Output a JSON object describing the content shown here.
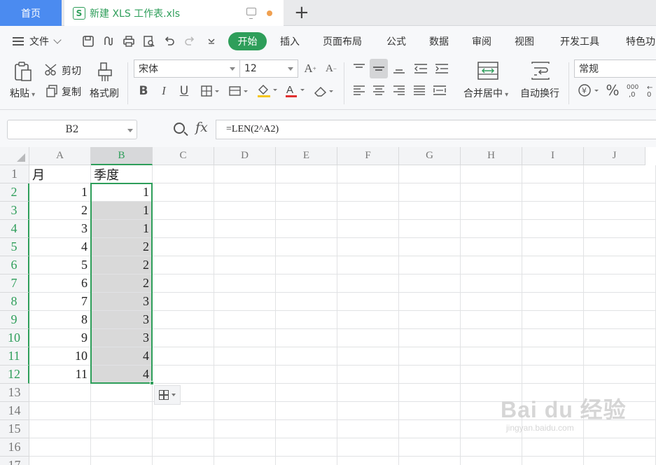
{
  "tabs": {
    "home": "首页",
    "doc_icon": "S",
    "doc_title": "新建 XLS 工作表.xls",
    "new_tab": "+"
  },
  "menu": {
    "file": "文件",
    "items": [
      "开始",
      "插入",
      "页面布局",
      "公式",
      "数据",
      "审阅",
      "视图",
      "开发工具",
      "特色功"
    ]
  },
  "ribbon": {
    "paste": "粘贴",
    "cut": "剪切",
    "copy": "复制",
    "format_painter": "格式刷",
    "font_name": "宋体",
    "font_size": "12",
    "merge_center": "合并居中",
    "wrap_text": "自动换行",
    "number_format": "常规"
  },
  "formula_bar": {
    "name_box": "B2",
    "fx": "fx",
    "formula": "=LEN(2^A2)"
  },
  "sheet": {
    "columns": [
      "A",
      "B",
      "C",
      "D",
      "E",
      "F",
      "G",
      "H",
      "I",
      "J"
    ],
    "active_column": "B",
    "rows": [
      {
        "n": "1",
        "a": "月",
        "b": "季度"
      },
      {
        "n": "2",
        "a": "1",
        "b": "1"
      },
      {
        "n": "3",
        "a": "2",
        "b": "1"
      },
      {
        "n": "4",
        "a": "3",
        "b": "1"
      },
      {
        "n": "5",
        "a": "4",
        "b": "2"
      },
      {
        "n": "6",
        "a": "5",
        "b": "2"
      },
      {
        "n": "7",
        "a": "6",
        "b": "2"
      },
      {
        "n": "8",
        "a": "7",
        "b": "3"
      },
      {
        "n": "9",
        "a": "8",
        "b": "3"
      },
      {
        "n": "10",
        "a": "9",
        "b": "3"
      },
      {
        "n": "11",
        "a": "10",
        "b": "4"
      },
      {
        "n": "12",
        "a": "11",
        "b": "4"
      },
      {
        "n": "13",
        "a": "",
        "b": ""
      },
      {
        "n": "14",
        "a": "",
        "b": ""
      },
      {
        "n": "15",
        "a": "",
        "b": ""
      },
      {
        "n": "16",
        "a": "",
        "b": ""
      },
      {
        "n": "17",
        "a": "",
        "b": ""
      }
    ]
  },
  "watermark": {
    "big": "Bai du 经验",
    "small": "jingyan.baidu.com"
  },
  "colors": {
    "accent_green": "#2e9e5a",
    "home_tab_blue": "#4b8bf0"
  }
}
